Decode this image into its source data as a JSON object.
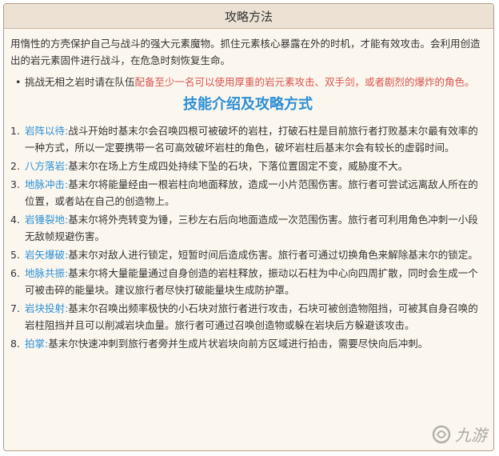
{
  "header": {
    "title": "攻略方法"
  },
  "intro": "用惰性的方壳保护自己与战斗的强大元素魔物。抓住元素核心暴露在外的时机，才能有效攻击。会利用创造出的岩元素固件进行战斗，在危急时刻恢复生命。",
  "tip": {
    "normal": "挑战无相之岩时请在队伍",
    "highlight": "配备至少一名可以使用厚重的岩元素攻击、双手剑，或者剧烈的爆炸的角色。"
  },
  "section_title": "技能介绍及攻略方式",
  "skills": [
    {
      "num": "1.",
      "name": "岩阵以待:",
      "desc": "战斗开始时基末尔会召唤四根可被破坏的岩柱，打破石柱是目前旅行者打败基末尔最有效率的一种方式，所以一定要携带一名可高效破坏岩柱的角色，破坏岩柱后基末尔会有较长的虚弱时间。"
    },
    {
      "num": "2.",
      "name": "八方落岩:",
      "desc": "基末尔在场上方生成四处持续下坠的石块，下落位置固定不变，威胁度不大。"
    },
    {
      "num": "3.",
      "name": "地脉冲击:",
      "desc": "基末尔将能量经由一根岩柱向地面释放，造成一小片范围伤害。旅行者可尝试远离敌人所在的位置，或者站在自己的创造物上。"
    },
    {
      "num": "4.",
      "name": "岩锤裂地:",
      "desc": "基末尔将外壳转变为锤，三秒左右后向地面造成一次范围伤害。旅行者可利用角色冲刺一小段无敌帧规避伤害。"
    },
    {
      "num": "5.",
      "name": "岩矢爆破:",
      "desc": "基末尔对敌人进行锁定，短暂时间后造成伤害。旅行者可通过切换角色来解除基末尔的锁定。"
    },
    {
      "num": "6.",
      "name": "地脉共振:",
      "desc": "基末尔将大量能量通过自身创造的岩柱释放，振动以石柱为中心向四周扩散，同时会生成一个可被击碎的能量块。建议旅行者尽快打破能量块生成防护罩。"
    },
    {
      "num": "7.",
      "name": "岩块投射:",
      "desc": "基末尔召唤出频率极快的小石块对旅行者进行攻击，石块可被创造物阻挡，可被其自身召唤的岩柱阻挡并且可以削减岩块血量。旅行者可通过召唤创造物或躲在岩块后方躲避该攻击。"
    },
    {
      "num": "8.",
      "name": "拍掌:",
      "desc": "基末尔快速冲刺到旅行者旁并生成片状岩块向前方区域进行拍击，需要尽快向后冲刺。"
    }
  ],
  "watermark": {
    "text": "九游"
  },
  "colors": {
    "accent": "#2d8fd5",
    "highlight": "#d9534f",
    "header_bg": "#ece1d3",
    "page_bg": "#fbf7ee"
  }
}
